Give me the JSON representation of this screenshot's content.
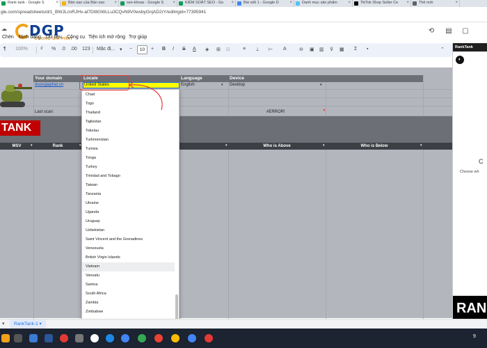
{
  "browser": {
    "tabs": [
      {
        "label": "Rank tank - Google S",
        "color": "#0f9d58",
        "active": true
      },
      {
        "label": "Bản sao của Bản sao",
        "color": "#f4b400"
      },
      {
        "label": "seo-khoas - Google S",
        "color": "#0f9d58"
      },
      {
        "label": "KIỂM SOÁT SEO - Go",
        "color": "#0f9d58"
      },
      {
        "label": "Bài viết 1 - Google D",
        "color": "#4285f4"
      },
      {
        "label": "Danh mục sản phẩm",
        "color": "#4fc3f7"
      },
      {
        "label": "TikTok Shop Seller Ce",
        "color": "#000000"
      },
      {
        "label": "Thẻ mới",
        "color": "#5f6368"
      }
    ],
    "url": "gle.com/spreadsheets/d/1_BWJLcnRJHv-al7DI8GWLLu3CQvN9V0wsbyGnjAD2rY/edit#gid=77395941"
  },
  "logo": {
    "text": "DGP",
    "subtext": "DUONG GIA PHAT"
  },
  "menu": [
    "Chèn",
    "Định dạng",
    "Dữ liệu",
    "Công cụ",
    "Tiện ích mở rộng",
    "Trợ giúp"
  ],
  "toolbar": {
    "zoom": "100%",
    "percent": "%",
    "dec_dec": ".0",
    "dec_inc": ".00",
    "num_format": "123",
    "font": "Mặc đị...",
    "font_size": "10",
    "bold": "B",
    "italic": "I"
  },
  "columns": [
    "B",
    "C",
    "D",
    "E",
    "F",
    "G"
  ],
  "headers": {
    "your_domain": "Your domain",
    "locale": "Locale",
    "language": "Language",
    "device": "Device"
  },
  "values": {
    "domain": "duongiaphat.vn",
    "locale": "United States",
    "language": "English",
    "device": "Desktop",
    "last_scan": "Last scan:",
    "error": "#ERROR!"
  },
  "banner": {
    "tank": "TANK"
  },
  "table_headers": {
    "msv": "MSV",
    "rank": "Rank",
    "who_above": "Who is Above",
    "who_below": "Who is Below"
  },
  "dropdown": {
    "options": [
      "Chad",
      "Togo",
      "Thailand",
      "Tajikistan",
      "Tokelau",
      "Turkmenistan",
      "Tunisia",
      "Tonga",
      "Turkey",
      "Trinidad and Tobago",
      "Taiwan",
      "Tanzania",
      "Ukraine",
      "Uganda",
      "Uruguay",
      "Uzbekistan",
      "Saint Vincent and the Grenadines",
      "Venezuela",
      "British Virgin Islands",
      "Vietnam",
      "Vanuatu",
      "Samoa",
      "South Africa",
      "Zambia",
      "Zimbabwe"
    ],
    "highlighted": "Vietnam"
  },
  "side_panel": {
    "title": "RankTank",
    "heading_char": "C",
    "choose_text": "Choose wh",
    "brand": "RAN"
  },
  "sheet_tab": "RankTank-1",
  "taskbar_right": "9"
}
